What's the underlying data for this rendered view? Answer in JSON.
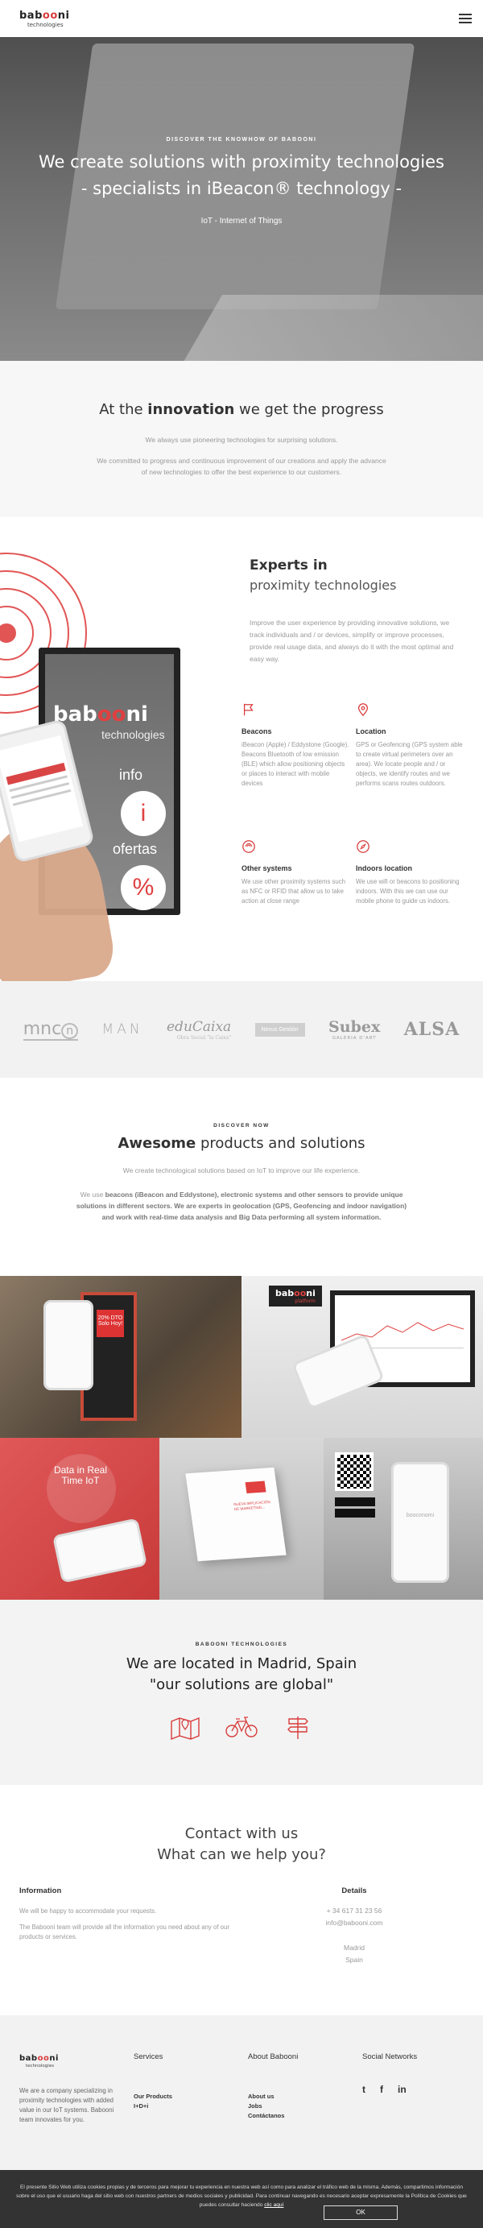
{
  "header": {
    "logo_main_black": "bab",
    "logo_main_red": "oo",
    "logo_main_end": "ni",
    "logo_sub": "technologies",
    "menu_icon": "hamburger-menu-icon"
  },
  "hero": {
    "kicker": "DISCOVER THE KNOWHOW OF BABOONI",
    "title_line1": "We create solutions with proximity technologies",
    "title_line2": "- specialists in iBeacon® technology -",
    "subtitle": "IoT - Internet of Things"
  },
  "innovation": {
    "title_pre": "At the ",
    "title_bold": "innovation",
    "title_post": " we get the progress",
    "line1": "We always use pioneering technologies for surprising solutions.",
    "line2": "We committed to progress and continuous improvement of our creations and apply the advance of new technologies to offer the best experience to our customers."
  },
  "experts": {
    "title": "Experts in",
    "subtitle": "proximity technologies",
    "intro": "Improve the user experience by providing innovative solutions, we track individuals and / or devices, simplify or improve processes, provide real usage data, and always do it with the most optimal and easy way.",
    "device": {
      "logo_black": "bab",
      "logo_red": "oo",
      "logo_end": "ni",
      "logo_sub": "technologies",
      "info": "info",
      "info_glyph": "i",
      "ofertas": "ofertas",
      "ofertas_glyph": "%"
    },
    "features": [
      {
        "icon": "flag-icon",
        "title": "Beacons",
        "text": "iBeacon (Apple) / Eddystone (Google). Beacons Bluetooth of low emission (BLE) which allow positioning objects or places to interact with mobile devices"
      },
      {
        "icon": "map-pin-icon",
        "title": "Location",
        "text": "GPS or Geofencing (GPS system able to create virtual perimeters over an area). We locate people and / or objects, we identify routes and we performs scans routes outdoors."
      },
      {
        "icon": "wifi-signal-icon",
        "title": "Other systems",
        "text": "We use other proximity systems such as NFC or RFID that allow us to take action at close range"
      },
      {
        "icon": "compass-icon",
        "title": "Indoors location",
        "text": "We use wifi or beacons to positioning indoors. With this we can use our mobile phone to guide us indoors."
      }
    ]
  },
  "clients": {
    "mnc": "mnc",
    "mnc_n": "n",
    "man": "MAN",
    "educaixa": "eduCaixa",
    "educaixa_sub": "Obra Social \"la Caixa\"",
    "nexus": "Nexus Gestión",
    "subex": "Subex",
    "subex_sub": "GALERIA D'ART",
    "alsa": "ALSA"
  },
  "products": {
    "kicker": "DISCOVER NOW",
    "title_bold": "Awesome",
    "title_rest": " products and solutions",
    "lead": "We create technological solutions based on IoT to improve our life experience.",
    "body_pre": "We use ",
    "body_bold": "beacons (iBeacon and Eddystone), electronic systems and other sensors to provide unique solutions in different sectors. We are experts in geolocation (GPS, Geofencing and indoor navigation) and work with real-time data analysis and Big Data performing all system information.",
    "tiles": {
      "sign_text": "20% DTO Solo Hoy!",
      "platform_black": "bab",
      "platform_red": "oo",
      "platform_end": "ni",
      "platform_sub": "platform",
      "data_bubble": "Data in Real Time IoT",
      "box_logo": "oo",
      "box_note": "NUEVA IMPLICACIÓN DE MARKETING...",
      "phone_logo": "booconomi"
    }
  },
  "location": {
    "kicker": "BABOONI TECHNOLOGIES",
    "title_line1": "We are located in Madrid, Spain",
    "title_line2": "\"our solutions are global\"",
    "icons": [
      "map-icon",
      "bicycle-icon",
      "signpost-icon"
    ]
  },
  "contact": {
    "title_line1": "Contact with us",
    "title_line2": "What can we help you?",
    "info_title": "Information",
    "info_line1": "We will be happy to accommodate your requests.",
    "info_line2": "The Babooni team will provide all the information you need about any of our products or services.",
    "details_title": "Details",
    "phone": "+ 34 617 31 23 56",
    "email": "info@babooni.com",
    "city": "Madrid",
    "country": "Spain"
  },
  "footer": {
    "logo_black": "bab",
    "logo_red": "oo",
    "logo_end": "ni",
    "logo_sub": "technologies",
    "about_text": "We are a company specializing in proximity technologies with added value in our IoT systems. Babooni team innovates for you.",
    "services_title": "Services",
    "services_links": [
      "Our Products",
      "I+D+i"
    ],
    "about_title": "About Babooni",
    "about_links": [
      "About us",
      "Jobs",
      "Contáctanos"
    ],
    "social_title": "Social Networks",
    "social": [
      "twitter-icon",
      "facebook-icon",
      "linkedin-icon"
    ],
    "social_glyphs": [
      "t",
      "f",
      "in"
    ]
  },
  "cookie": {
    "text": "El presente Sitio Web utiliza cookies propias y de terceros para mejorar tu experiencia en nuestra web así como para analizar el tráfico web de la misma. Además, compartimos información sobre el uso que el usuario haga del sitio web con nuestros partners de medios sociales y publicidad. Para continuar navegando es necesario aceptar expresamente la Política de Cookies que puedes consultar haciendo ",
    "link": "clic aquí",
    "button": "OK"
  },
  "colors": {
    "brand_red": "#d93b3b",
    "dark": "#333333",
    "muted_text": "#999999",
    "light_bg": "#f2f2f2"
  }
}
